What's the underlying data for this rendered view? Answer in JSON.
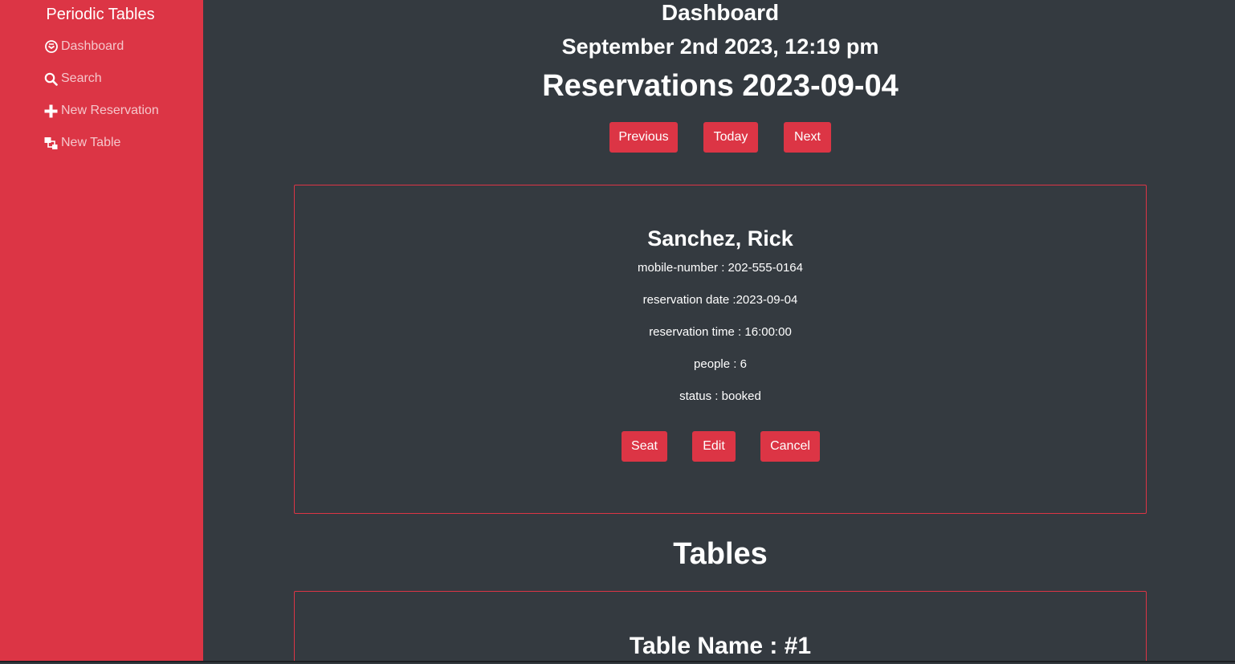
{
  "sidebar": {
    "brand": "Periodic Tables",
    "items": [
      {
        "label": "Dashboard",
        "icon": "dashboard-icon"
      },
      {
        "label": "Search",
        "icon": "search-icon"
      },
      {
        "label": "New Reservation",
        "icon": "plus-icon"
      },
      {
        "label": "New Table",
        "icon": "tables-icon"
      }
    ]
  },
  "header": {
    "title": "Dashboard",
    "datetime": "September 2nd 2023, 12:19 pm",
    "reservations_heading": "Reservations 2023-09-04"
  },
  "date_nav": {
    "previous": "Previous",
    "today": "Today",
    "next": "Next"
  },
  "reservation": {
    "name": "Sanchez, Rick",
    "mobile": "mobile-number : 202-555-0164",
    "date": "reservation date :2023-09-04",
    "time": "reservation time : 16:00:00",
    "people": "people : 6",
    "status": "status : booked",
    "actions": {
      "seat": "Seat",
      "edit": "Edit",
      "cancel": "Cancel"
    }
  },
  "tables": {
    "heading": "Tables",
    "items": [
      {
        "name": "Table Name : #1"
      }
    ]
  },
  "colors": {
    "accent": "#dc3545",
    "background": "#343a40",
    "text": "#ffffff"
  }
}
